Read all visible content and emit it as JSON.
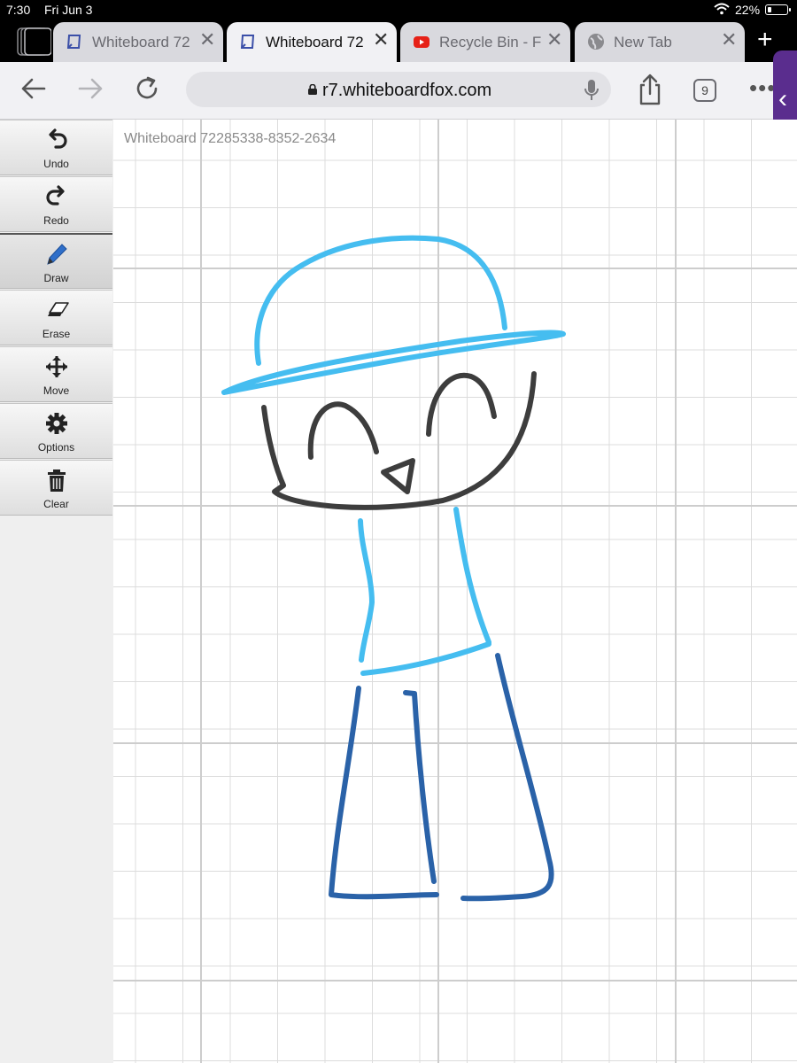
{
  "status_bar": {
    "time": "7:30",
    "date": "Fri Jun 3",
    "battery": "22%",
    "battery_level": 0.22
  },
  "tabs": [
    {
      "label": "Whiteboard 72",
      "active": false,
      "icon": "whiteboard-favicon"
    },
    {
      "label": "Whiteboard 72",
      "active": true,
      "icon": "whiteboard-favicon"
    },
    {
      "label": "Recycle Bin - F",
      "active": false,
      "icon": "youtube-favicon"
    },
    {
      "label": "New Tab",
      "active": false,
      "icon": "globe-icon"
    }
  ],
  "tab_close_glyph": "✕",
  "new_tab_glyph": "+",
  "address_bar": {
    "url": "r7.whiteboardfox.com",
    "tab_count": "9"
  },
  "side_handle_glyph": "‹",
  "tools": [
    {
      "label": "Undo",
      "icon": "undo-icon",
      "selected": false
    },
    {
      "label": "Redo",
      "icon": "redo-icon",
      "selected": false
    },
    {
      "label": "Draw",
      "icon": "pencil-icon",
      "selected": true
    },
    {
      "label": "Erase",
      "icon": "eraser-icon",
      "selected": false
    },
    {
      "label": "Move",
      "icon": "move-arrows-icon",
      "selected": false
    },
    {
      "label": "Options",
      "icon": "gear-icon",
      "selected": false
    },
    {
      "label": "Clear",
      "icon": "trash-icon",
      "selected": false
    }
  ],
  "board": {
    "title": "Whiteboard 72285338-8352-2634"
  },
  "colors": {
    "light_blue": "#45bdf0",
    "dark_blue": "#2a62a8",
    "dark_gray": "#3d3d3d",
    "accent_purple": "#5a2d8e"
  }
}
